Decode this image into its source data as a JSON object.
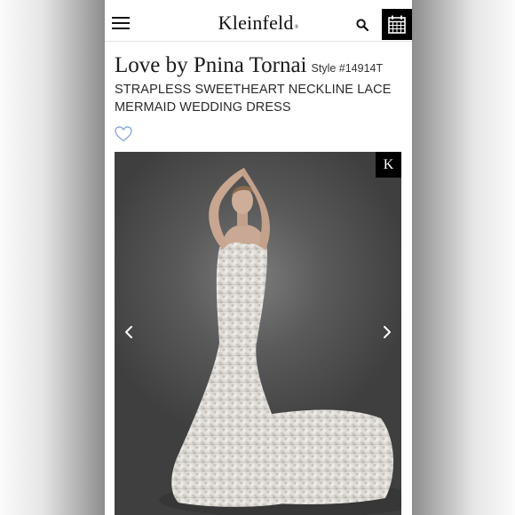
{
  "header": {
    "logo_text": "Kleinfeld",
    "logo_mark": "®",
    "menu_icon": "hamburger-menu-icon",
    "search_icon": "search-icon",
    "calendar_icon": "calendar-icon"
  },
  "product": {
    "designer": "Love by Pnina Tornai",
    "style_number": "Style #14914T",
    "description": "STRAPLESS SWEETHEART NECKLINE LACE MERMAID WEDDING DRESS",
    "favorite_icon": "heart-outline-icon"
  },
  "gallery": {
    "badge": "K",
    "prev_icon": "chevron-left-icon",
    "next_icon": "chevron-right-icon"
  },
  "colors": {
    "accent_heart": "#8aa9d6",
    "header_button": "#000000",
    "photo_background": "#5a5a5a"
  }
}
